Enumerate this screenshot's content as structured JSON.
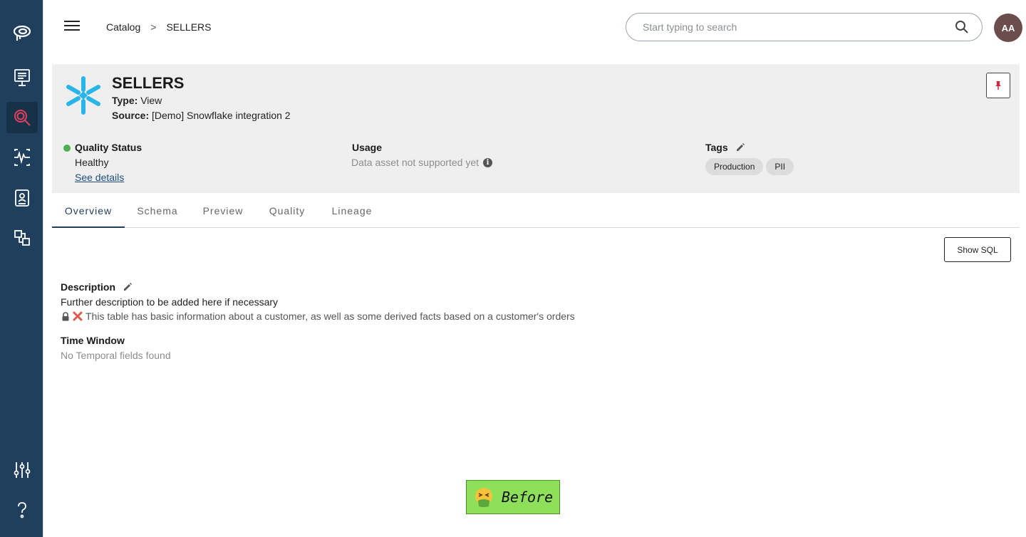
{
  "nav": {
    "items": [
      {
        "name": "logo",
        "active": false
      },
      {
        "name": "dashboards",
        "active": false
      },
      {
        "name": "catalog",
        "active": true
      },
      {
        "name": "monitors",
        "active": false
      },
      {
        "name": "reports",
        "active": false
      },
      {
        "name": "integrations",
        "active": false
      },
      {
        "name": "settings",
        "active": false
      },
      {
        "name": "help",
        "active": false
      }
    ],
    "accent": "#e0405a",
    "background": "#1f3f5c"
  },
  "topbar": {
    "breadcrumbs": [
      "Catalog",
      "SELLERS"
    ],
    "separator": ">",
    "search_placeholder": "Start typing to search",
    "avatar_initials": "AA"
  },
  "asset": {
    "title": "SELLERS",
    "type_label": "Type:",
    "type_value": "View",
    "source_label": "Source:",
    "source_value": "[Demo] Snowflake integration 2",
    "icon": "snowflake-icon"
  },
  "quality": {
    "label": "Quality Status",
    "value": "Healthy",
    "details_link": "See details",
    "status_color": "#4caf50"
  },
  "usage": {
    "label": "Usage",
    "value": "Data asset not supported yet"
  },
  "tags": {
    "label": "Tags",
    "items": [
      "Production",
      "PII"
    ]
  },
  "tabs": [
    {
      "label": "Overview",
      "active": true
    },
    {
      "label": "Schema",
      "active": false
    },
    {
      "label": "Preview",
      "active": false
    },
    {
      "label": "Quality",
      "active": false
    },
    {
      "label": "Lineage",
      "active": false
    }
  ],
  "actions": {
    "show_sql": "Show SQL"
  },
  "description": {
    "title": "Description",
    "text": "Further description to be added here if necessary",
    "source_text": "This table has basic information about a customer, as well as some derived facts based on a customer's orders"
  },
  "time_window": {
    "title": "Time Window",
    "text": "No Temporal fields found"
  },
  "badge": {
    "label": "Before"
  }
}
